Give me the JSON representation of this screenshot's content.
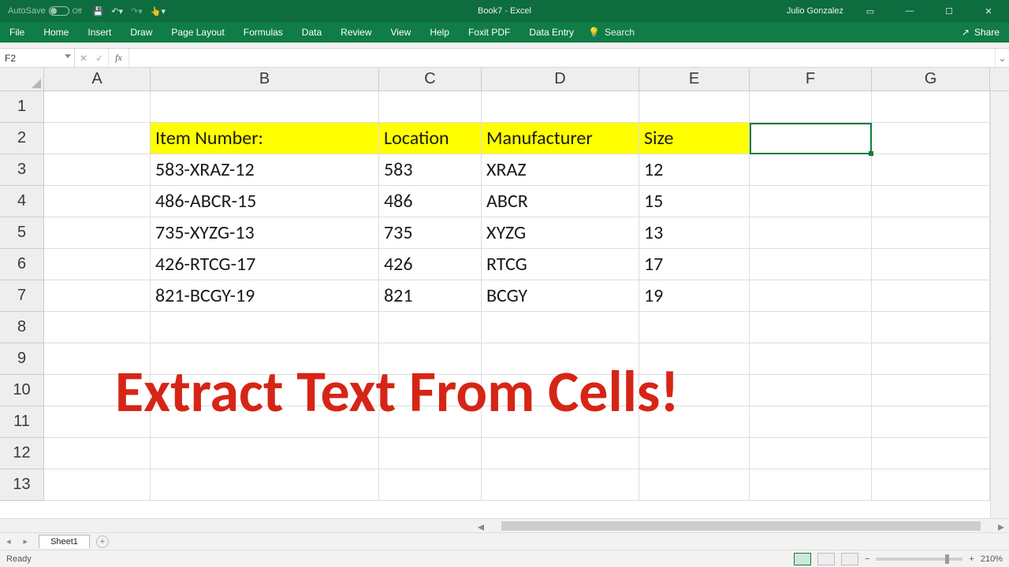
{
  "title": {
    "doc": "Book7",
    "app": "Excel",
    "autosave": "AutoSave",
    "autosave_state": "Off"
  },
  "user": "Julio Gonzalez",
  "ribbon_tabs": [
    "File",
    "Home",
    "Insert",
    "Draw",
    "Page Layout",
    "Formulas",
    "Data",
    "Review",
    "View",
    "Help",
    "Foxit PDF",
    "Data Entry"
  ],
  "tell_me": "Search",
  "share": "Share",
  "namebox": "F2",
  "fx_label": "fx",
  "formula": "",
  "columns": [
    "A",
    "B",
    "C",
    "D",
    "E",
    "F",
    "G"
  ],
  "col_widths": [
    "w-A",
    "w-B",
    "w-C",
    "w-D",
    "w-E",
    "w-F",
    "w-G"
  ],
  "rows": [
    "1",
    "2",
    "3",
    "4",
    "5",
    "6",
    "7",
    "8",
    "9",
    "10",
    "11",
    "12",
    "13"
  ],
  "headers": {
    "B2": "Item Number:",
    "C2": "Location",
    "D2": "Manufacturer",
    "E2": "Size"
  },
  "data": [
    {
      "B": "583-XRAZ-12",
      "C": "583",
      "D": "XRAZ",
      "E": "12"
    },
    {
      "B": "486-ABCR-15",
      "C": "486",
      "D": "ABCR",
      "E": "15"
    },
    {
      "B": "735-XYZG-13",
      "C": "735",
      "D": "XYZG",
      "E": "13"
    },
    {
      "B": "426-RTCG-17",
      "C": "426",
      "D": "RTCG",
      "E": "17"
    },
    {
      "B": "821-BCGY-19",
      "C": "821",
      "D": "BCGY",
      "E": "19"
    }
  ],
  "overlay_text": "Extract Text From Cells!",
  "sheet": "Sheet1",
  "status": "Ready",
  "zoom": "210%",
  "selected_cell": "F2"
}
